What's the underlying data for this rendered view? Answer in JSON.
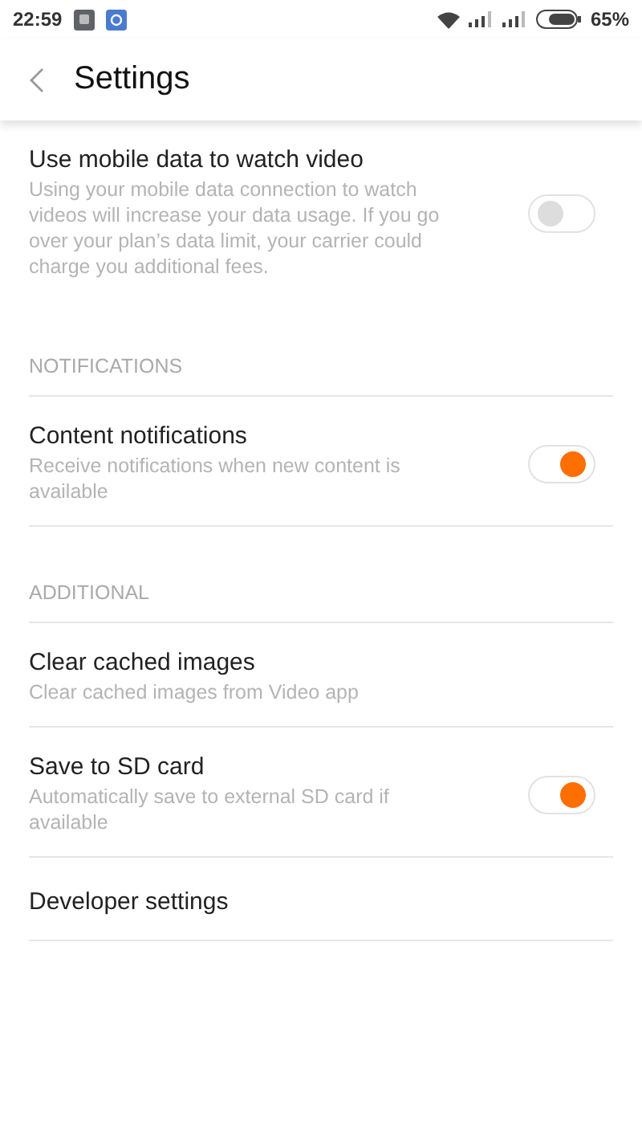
{
  "status_bar": {
    "time": "22:59",
    "battery": "65%"
  },
  "header": {
    "title": "Settings"
  },
  "sections": [
    {
      "items": [
        {
          "kind": "toggle",
          "title": "Use mobile data to watch video",
          "description": "Using your mobile data connection to watch videos will increase your data usage. If you go over your plan’s data limit, your carrier could charge you additional fees.",
          "on": false
        }
      ]
    },
    {
      "heading": "NOTIFICATIONS",
      "items": [
        {
          "kind": "toggle",
          "title": "Content notifications",
          "description": "Receive notifications when new content is available",
          "on": true
        }
      ]
    },
    {
      "heading": "ADDITIONAL",
      "items": [
        {
          "kind": "plain",
          "title": "Clear cached images",
          "description": "Clear cached images from Video app"
        },
        {
          "kind": "toggle",
          "title": "Save to SD card",
          "description": "Automatically save to external SD card if available",
          "on": true
        },
        {
          "kind": "plain",
          "title": "Developer settings"
        }
      ]
    }
  ]
}
